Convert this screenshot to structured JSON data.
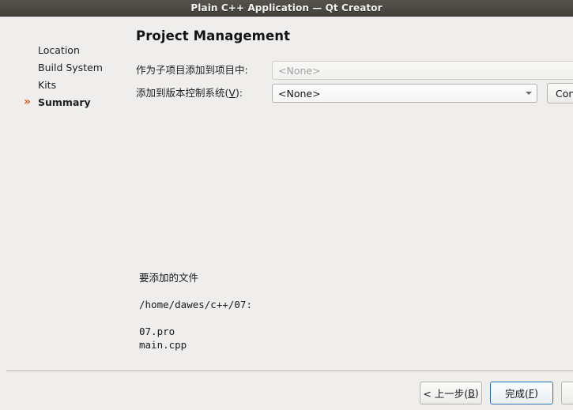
{
  "window": {
    "title": "Plain C++ Application — Qt Creator"
  },
  "sidebar": {
    "marker_glyph": "»",
    "items": [
      {
        "label": "Location",
        "current": false
      },
      {
        "label": "Build System",
        "current": false
      },
      {
        "label": "Kits",
        "current": false
      },
      {
        "label": "Summary",
        "current": true
      }
    ]
  },
  "main": {
    "page_title": "Project Management",
    "fields": [
      {
        "label": "作为子项目添加到项目中:",
        "value": "<None>",
        "enabled": false
      },
      {
        "label_prefix": "添加到版本控制系统(",
        "label_mnemonic": "V",
        "label_suffix": "):",
        "value": "<None>",
        "enabled": true
      }
    ],
    "configure_button": {
      "label": "Conf"
    },
    "file_summary": "要添加的文件\n\n/home/dawes/c++/07:\n\n07.pro\nmain.cpp"
  },
  "footer": {
    "back_button": {
      "prefix": "< 上一步(",
      "mnemonic": "B",
      "suffix": ")"
    },
    "finish_button": {
      "prefix": "完成(",
      "mnemonic": "F",
      "suffix": ")"
    },
    "cancel_button": {
      "label": ""
    }
  },
  "colors": {
    "titlebar": "#4c4a45",
    "background": "#efeeec",
    "marker_orange": "#d95b1e",
    "default_button_border": "#1d6fb8"
  }
}
